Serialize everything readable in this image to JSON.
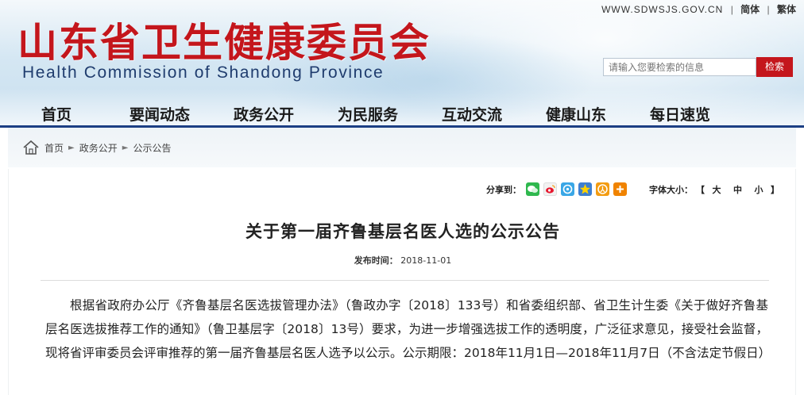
{
  "header": {
    "logo_cn": "山东省卫生健康委员会",
    "logo_en": "Health Commission of Shandong Province",
    "site_url": "WWW.SDWSJS.GOV.CN",
    "lang_simplified": "简体",
    "lang_traditional": "繁体",
    "search": {
      "placeholder": "请输入您要检索的信息",
      "button": "检索"
    }
  },
  "nav": {
    "items": [
      "首页",
      "要闻动态",
      "政务公开",
      "为民服务",
      "互动交流",
      "健康山东",
      "每日速览"
    ],
    "accent_color": "#1c3f84"
  },
  "breadcrumb": {
    "items": [
      "首页",
      "政务公开",
      "公示公告"
    ]
  },
  "article_tools": {
    "share_label": "分享到：",
    "share_icons": [
      "wechat-icon",
      "weibo-icon",
      "qzone-icon",
      "qq-space-icon",
      "renren-icon",
      "more-share-icon"
    ],
    "font_size_label": "字体大小：",
    "bracket_open": "【",
    "bracket_close": "】",
    "font_sizes": [
      "大",
      "中",
      "小"
    ]
  },
  "article": {
    "title": "关于第一届齐鲁基层名医人选的公示公告",
    "date_label": "发布时间：",
    "date": "2018-11-01",
    "body": "根据省政府办公厅《齐鲁基层名医选拔管理办法》（鲁政办字〔2018〕133号）和省委组织部、省卫生计生委《关于做好齐鲁基层名医选拔推荐工作的通知》（鲁卫基层字〔2018〕13号）要求，为进一步增强选拔工作的透明度，广泛征求意见，接受社会监督，现将省评审委员会评审推荐的第一届齐鲁基层名医人选予以公示。公示期限：2018年11月1日—2018年11月7日（不含法定节假日）"
  },
  "colors": {
    "brand_red": "#c4161c",
    "title_blue": "#1f3c6e"
  }
}
